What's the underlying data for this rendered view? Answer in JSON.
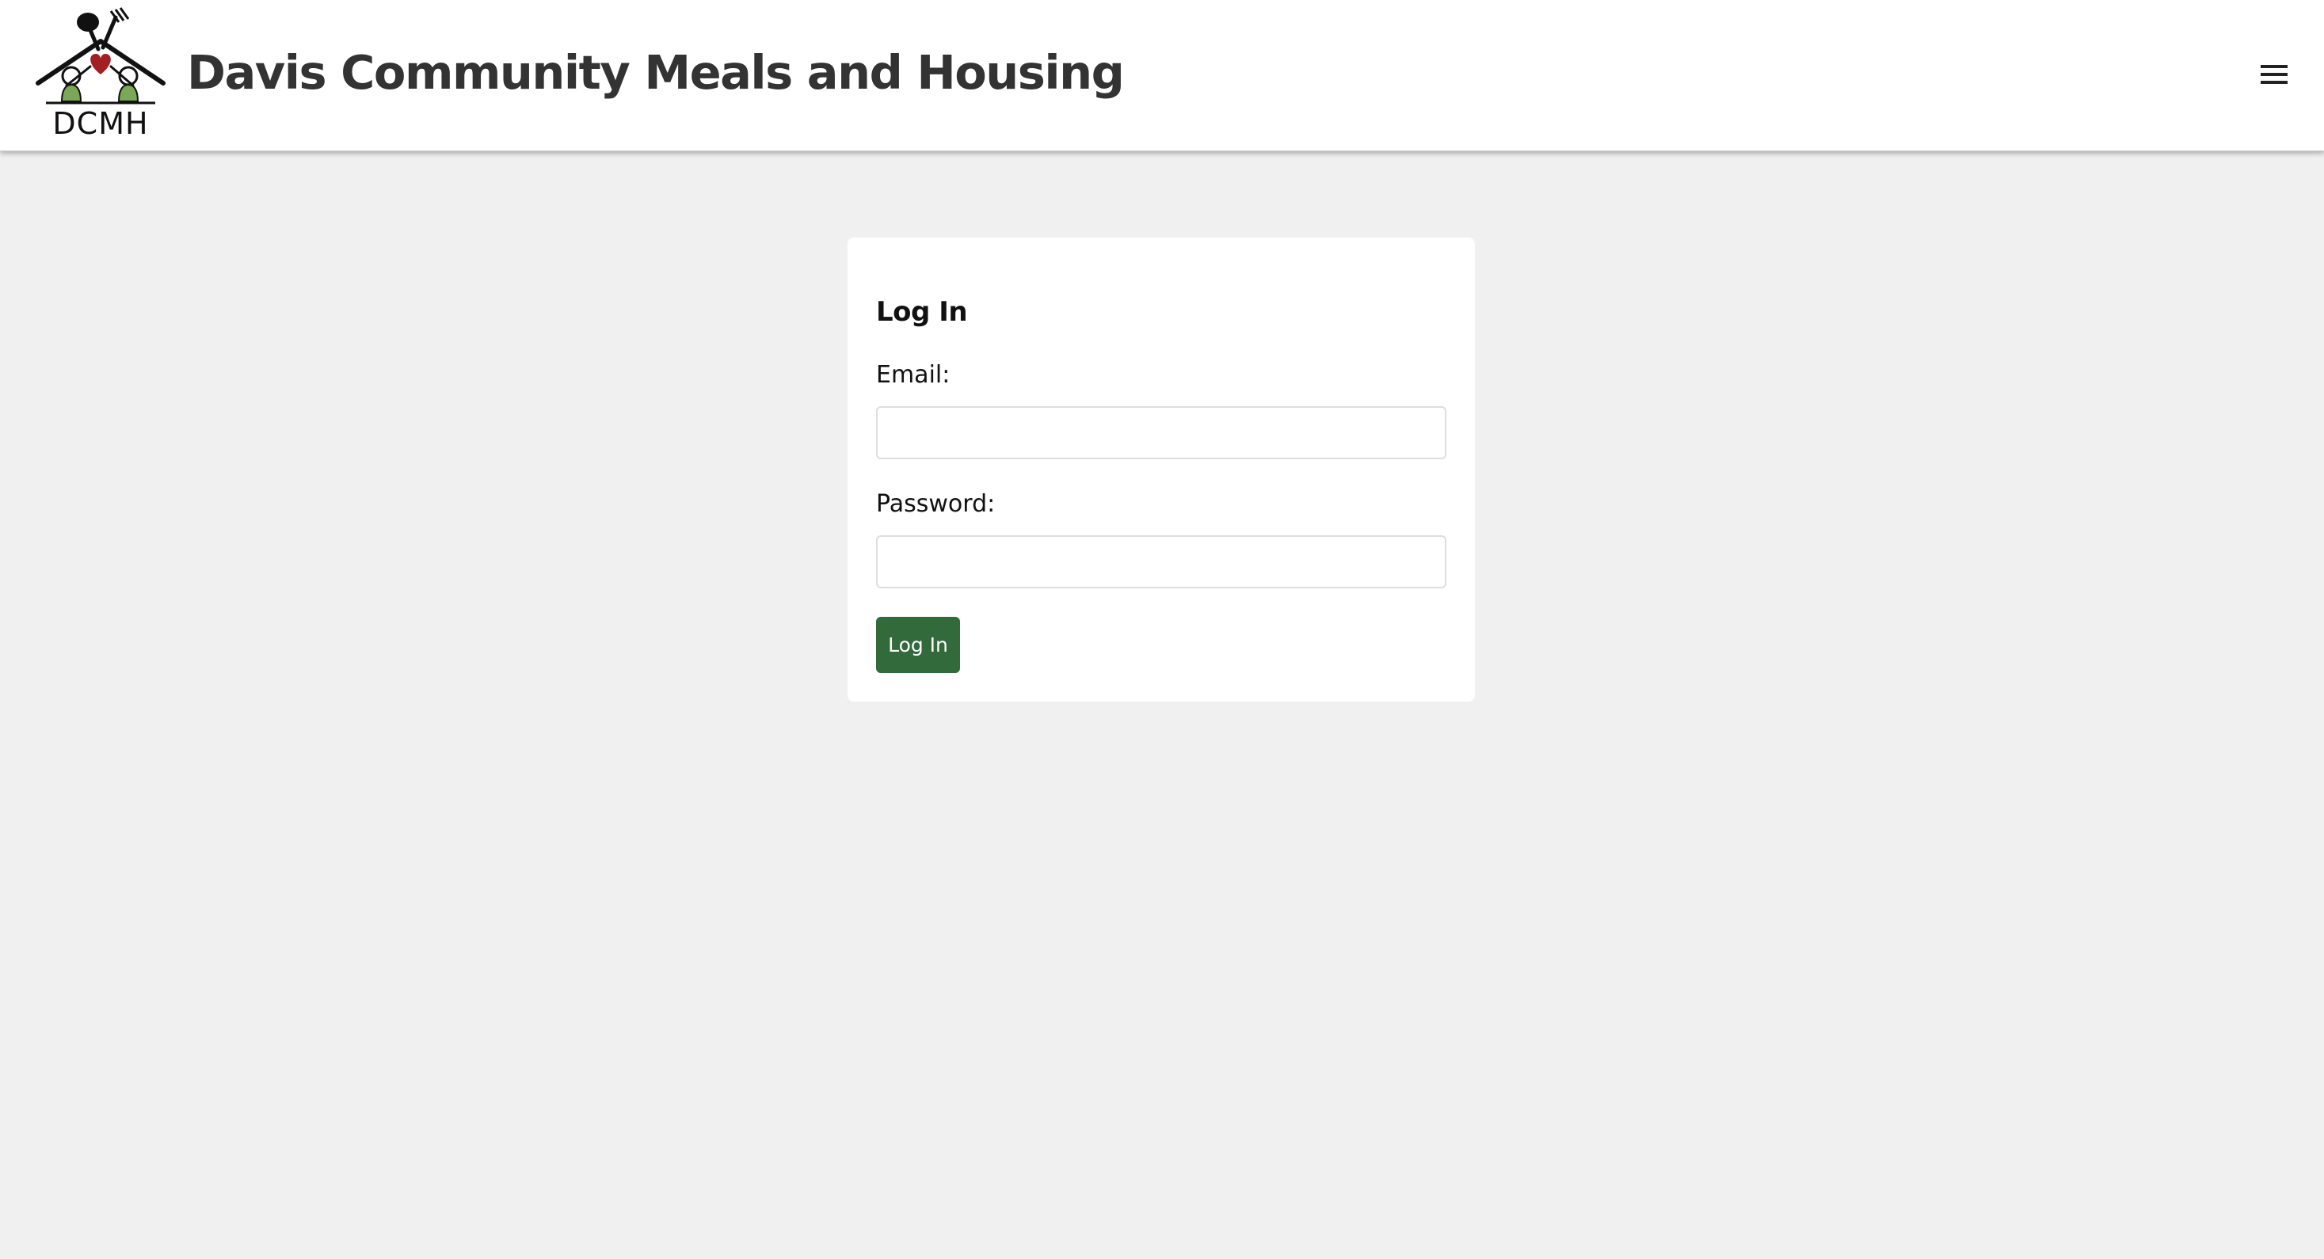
{
  "header": {
    "logo_text": "DCMH",
    "title": "Davis Community Meals and Housing",
    "menu_icon": "hamburger-menu-icon"
  },
  "login_form": {
    "title": "Log In",
    "email_label": "Email:",
    "email_value": "",
    "password_label": "Password:",
    "password_value": "",
    "submit_label": "Log In"
  },
  "colors": {
    "page_background": "#f0f0f0",
    "header_background": "#ffffff",
    "card_background": "#ffffff",
    "title_text": "#333333",
    "button_background": "#336a3c",
    "button_text": "#ffffff",
    "logo_heart": "#a31f24",
    "logo_figures": "#7aa857"
  }
}
